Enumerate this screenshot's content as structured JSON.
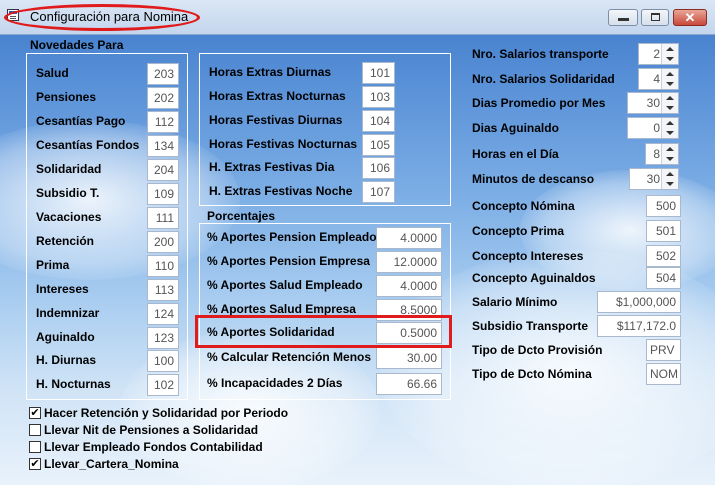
{
  "window": {
    "title": "Configuración para Nomina"
  },
  "novedades": {
    "title": "Novedades Para",
    "items": [
      {
        "label": "Salud",
        "value": "203"
      },
      {
        "label": "Pensiones",
        "value": "202"
      },
      {
        "label": "Cesantías Pago",
        "value": "112"
      },
      {
        "label": "Cesantías Fondos",
        "value": "134"
      },
      {
        "label": "Solidaridad",
        "value": "204"
      },
      {
        "label": "Subsidio T.",
        "value": "109"
      },
      {
        "label": "Vacaciones",
        "value": "111"
      },
      {
        "label": "Retención",
        "value": "200"
      },
      {
        "label": "Prima",
        "value": "110"
      },
      {
        "label": "Intereses",
        "value": "113"
      },
      {
        "label": "Indemnizar",
        "value": "124"
      },
      {
        "label": "Aguinaldo",
        "value": "123"
      },
      {
        "label": "H. Diurnas",
        "value": "100"
      },
      {
        "label": "H. Nocturnas",
        "value": "102"
      }
    ]
  },
  "horas": {
    "items": [
      {
        "label": "Horas Extras Diurnas",
        "value": "101"
      },
      {
        "label": "Horas Extras Nocturnas",
        "value": "103"
      },
      {
        "label": "Horas Festivas Diurnas",
        "value": "104"
      },
      {
        "label": "Horas Festivas Nocturnas",
        "value": "105"
      },
      {
        "label": "H. Extras Festivas Dia",
        "value": "106"
      },
      {
        "label": "H. Extras Festivas Noche",
        "value": "107"
      }
    ]
  },
  "porcentajes": {
    "title": "Porcentajes",
    "items": [
      {
        "label": "% Aportes Pension Empleado",
        "value": "4.0000"
      },
      {
        "label": "% Aportes Pension Empresa",
        "value": "12.0000"
      },
      {
        "label": "% Aportes Salud Empleado",
        "value": "4.0000"
      },
      {
        "label": "% Aportes Salud Empresa",
        "value": "8.5000"
      },
      {
        "label": "% Aportes Solidaridad",
        "value": "0.5000"
      },
      {
        "label": "% Calcular Retención Menos",
        "value": "30.00"
      },
      {
        "label": "% Incapacidades 2 Días",
        "value": "66.66"
      }
    ]
  },
  "config": {
    "spinners": [
      {
        "label": "Nro. Salarios transporte",
        "value": "2"
      },
      {
        "label": "Nro. Salarios Solidaridad",
        "value": "4"
      },
      {
        "label": "Dias Promedio por Mes",
        "value": "30"
      },
      {
        "label": "Dias Aguinaldo",
        "value": "0"
      },
      {
        "label": "Horas en el Día",
        "value": "8"
      },
      {
        "label": "Minutos de descanso",
        "value": "30"
      }
    ],
    "conceptos": [
      {
        "label": "Concepto Nómina",
        "value": "500"
      },
      {
        "label": "Concepto Prima",
        "value": "501"
      },
      {
        "label": "Concepto Intereses",
        "value": "502"
      },
      {
        "label": "Concepto Aguinaldos",
        "value": "504"
      }
    ],
    "salario_minimo": {
      "label": "Salario Mínimo",
      "value": "$1,000,000"
    },
    "subsidio_transporte": {
      "label": "Subsidio Transporte",
      "value": "$117,172.0"
    },
    "dcto_provision": {
      "label": "Tipo de Dcto Provisión",
      "value": "PRV"
    },
    "dcto_nomina": {
      "label": "Tipo de Dcto Nómina",
      "value": "NOM"
    }
  },
  "checks": [
    {
      "label": "Hacer Retención y Solidaridad por Periodo",
      "checked": true,
      "mark": "✔"
    },
    {
      "label": "Llevar Nit de Pensiones a Solidaridad",
      "checked": false,
      "mark": ""
    },
    {
      "label": "Llevar Empleado Fondos Contabilidad",
      "checked": false,
      "mark": ""
    },
    {
      "label": "Llevar_Cartera_Nomina",
      "checked": true,
      "mark": "✔"
    }
  ],
  "colors": {
    "highlight": "#e01b1b",
    "sky_top": "#3d79c9"
  },
  "icons": [
    "app-icon",
    "minimize-icon",
    "maximize-icon",
    "close-icon"
  ]
}
